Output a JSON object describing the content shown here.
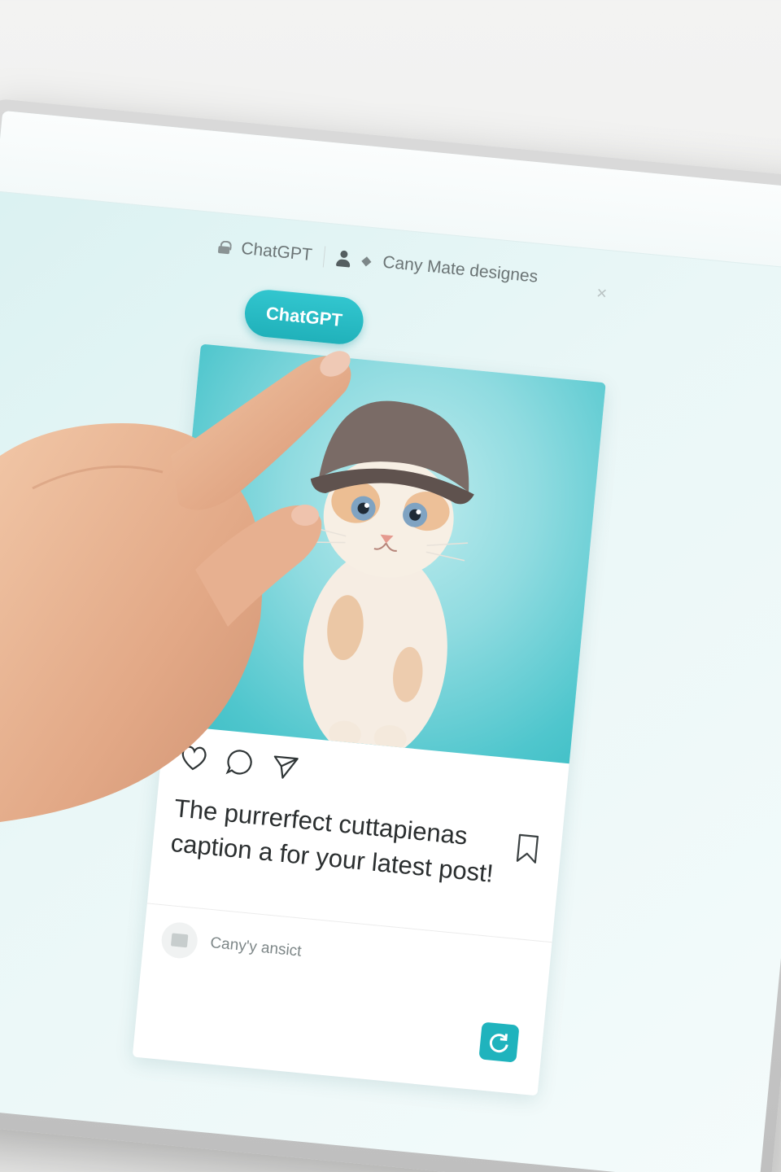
{
  "topbar": {
    "app_label": "ChatGPT",
    "account_label": "Cany Mate designes",
    "close_glyph": "×"
  },
  "chat_button": {
    "label": "ChatGPT"
  },
  "post": {
    "caption": "The purrerfect cuttapienas caption a for your latest post!",
    "comment_placeholder": "Cany'y ansict"
  },
  "colors": {
    "accent": "#20b1ba",
    "screen_bg": "#eaf7f7",
    "image_bg": "#4fc6cd"
  },
  "icons": {
    "lock": "lock-icon",
    "user": "user-icon",
    "close": "close-icon",
    "heart": "heart-icon",
    "comment": "comment-icon",
    "share": "share-icon",
    "bookmark": "bookmark-icon",
    "refresh": "refresh-icon"
  }
}
